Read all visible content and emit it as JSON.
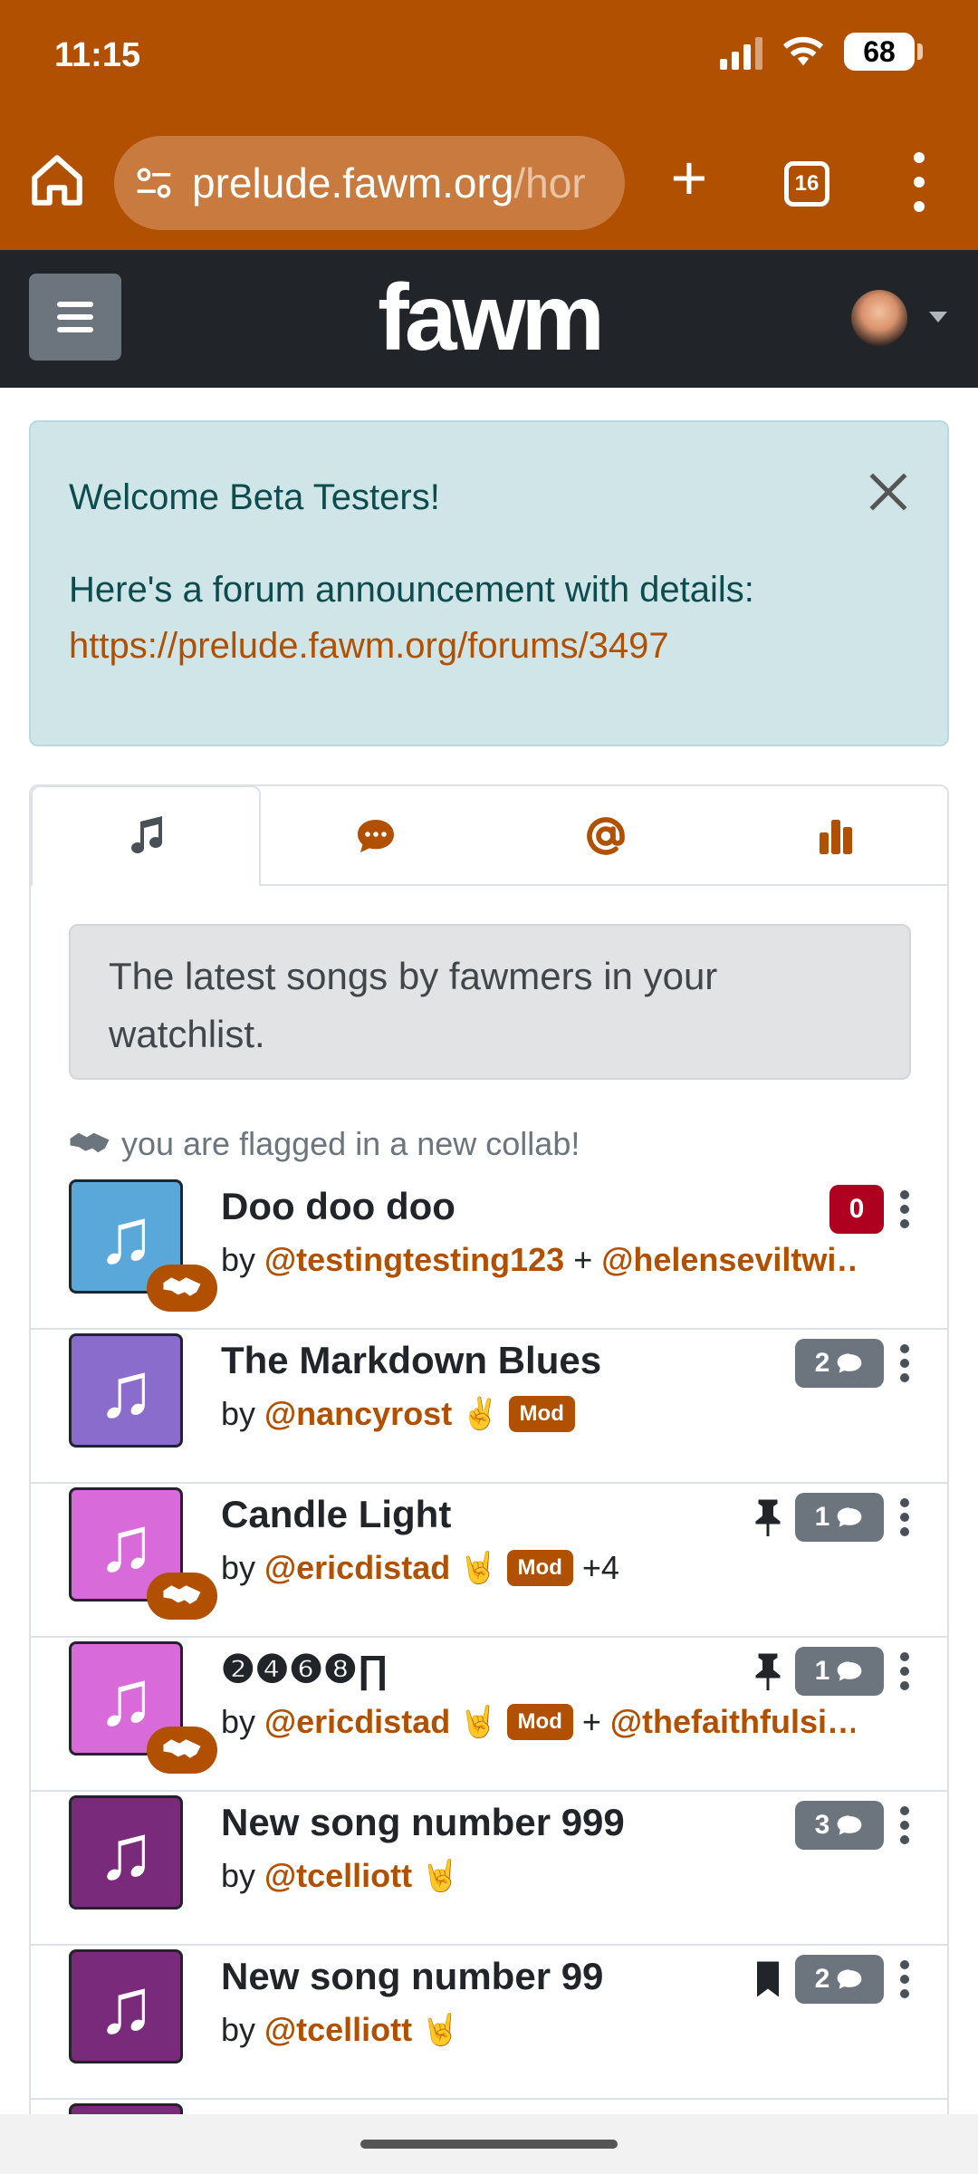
{
  "status": {
    "time": "11:15",
    "battery": "68"
  },
  "browser": {
    "url_main": "prelude.fawm.org",
    "url_rest": "/hor",
    "tab_count": "16"
  },
  "site": {
    "logo": "fawm"
  },
  "alert": {
    "title": "Welcome Beta Testers!",
    "body": "Here's a forum announcement with details:",
    "link": "https://prelude.fawm.org/forums/3497"
  },
  "tabs": [
    {
      "icon": "music-note-icon"
    },
    {
      "icon": "chat-bubble-icon"
    },
    {
      "icon": "at-sign-icon"
    },
    {
      "icon": "bar-chart-icon"
    }
  ],
  "info": "The latest songs by fawmers in your watchlist.",
  "collab_note": "you are flagged in a new collab!",
  "songs": [
    {
      "title": "Doo doo doo",
      "by": "by",
      "user": "@testingtesting123",
      "plus": "+",
      "extra": "@helenseviltwi…",
      "badge": "0"
    },
    {
      "title": "The Markdown Blues",
      "by": "by",
      "user": "@nancyrost",
      "emoji": "✌",
      "mod": "Mod",
      "badge": "2"
    },
    {
      "title": "Candle Light",
      "by": "by",
      "user": "@ericdistad",
      "emoji": "🤘",
      "mod": "Mod",
      "plus": "+4",
      "badge": "1"
    },
    {
      "title": "❷❹❻❽∏",
      "by": "by",
      "user": "@ericdistad",
      "emoji": "🤘",
      "mod": "Mod",
      "plus": "+",
      "extra": "@thefaithfulsi…",
      "badge": "1"
    },
    {
      "title": "New song number 999",
      "by": "by",
      "user": "@tcelliott",
      "emoji": "🤘",
      "badge": "3"
    },
    {
      "title": "New song number 99",
      "by": "by",
      "user": "@tcelliott",
      "emoji": "🤘",
      "badge": "2"
    }
  ],
  "colors": {
    "brand": "#b05000",
    "navbar": "#212529",
    "alert_bg": "#cfe5e7",
    "badge_gray": "#6c757d",
    "badge_red": "#b00020"
  }
}
